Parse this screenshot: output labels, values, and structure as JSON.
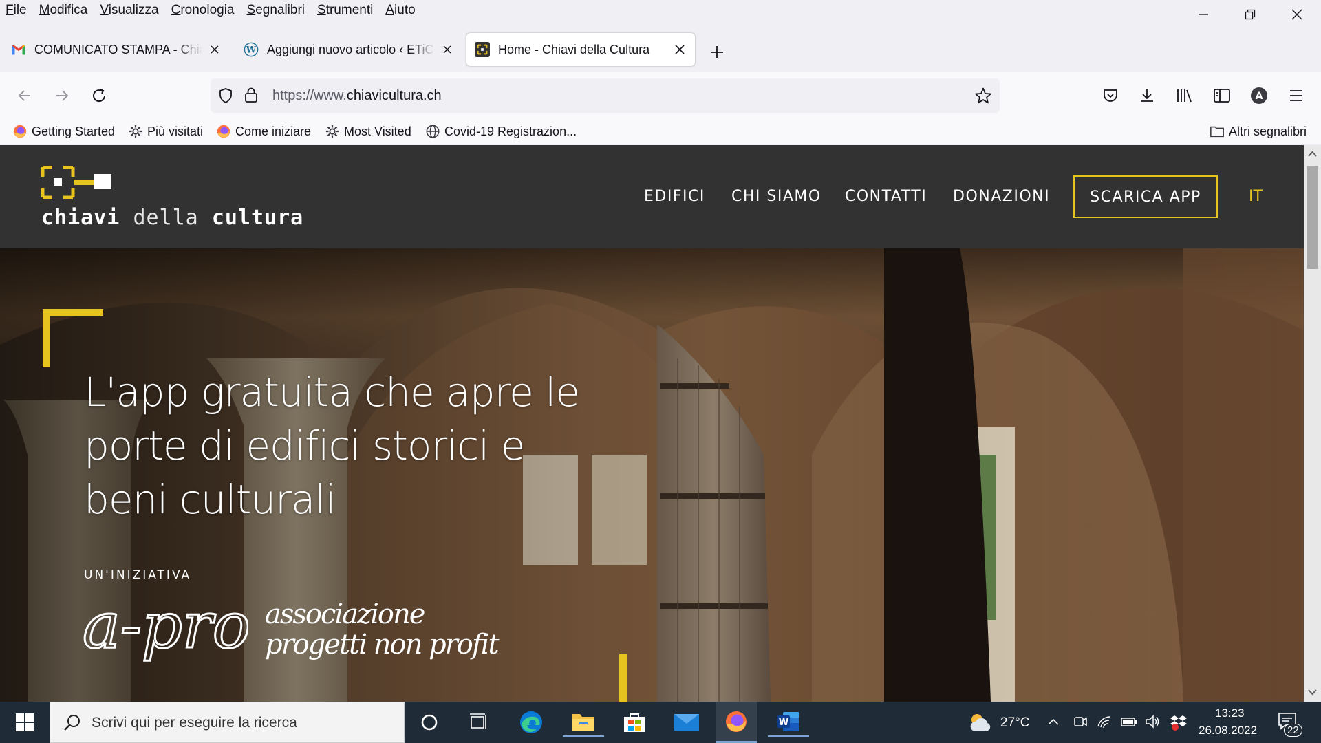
{
  "menu": [
    "File",
    "Modifica",
    "Visualizza",
    "Cronologia",
    "Segnalibri",
    "Strumenti",
    "Aiuto"
  ],
  "tabs": [
    {
      "title": "COMUNICATO STAMPA - Chiavi della Cultura",
      "icon": "gmail-icon"
    },
    {
      "title": "Aggiungi nuovo articolo ‹ ETiCi",
      "icon": "wordpress-icon"
    },
    {
      "title": "Home - Chiavi della Cultura",
      "icon": "site-favicon"
    }
  ],
  "url": {
    "dim": "https://www.",
    "main": "chiavicultura.ch"
  },
  "bookmarks": [
    {
      "label": "Getting Started",
      "icon": "firefox-icon"
    },
    {
      "label": "Più visitati",
      "icon": "gear-icon"
    },
    {
      "label": "Come iniziare",
      "icon": "firefox-icon"
    },
    {
      "label": "Most Visited",
      "icon": "gear-icon"
    },
    {
      "label": "Covid-19 Registrazion...",
      "icon": "globe-icon"
    }
  ],
  "other_bookmarks": "Altri segnalibri",
  "site": {
    "logo_bold1": "chiavi",
    "logo_light": "della",
    "logo_bold2": "cultura",
    "nav": [
      "EDIFICI",
      "CHI SIAMO",
      "CONTATTI",
      "DONAZIONI"
    ],
    "cta": "SCARICA APP",
    "lang": "IT",
    "hero_title": "L'app gratuita che apre le porte di edifici storici e beni culturali",
    "initiative": "UN'INIZIATIVA",
    "apro_logo": "a-pro",
    "apro_line1": "associazione",
    "apro_line2": "progetti non profit"
  },
  "taskbar": {
    "search_placeholder": "Scrivi qui per eseguire la ricerca",
    "temperature": "27°C",
    "time": "13:23",
    "date": "26.08.2022",
    "notifications": "22"
  },
  "colors": {
    "accent": "#e6c31e",
    "header_bg": "#323232"
  }
}
